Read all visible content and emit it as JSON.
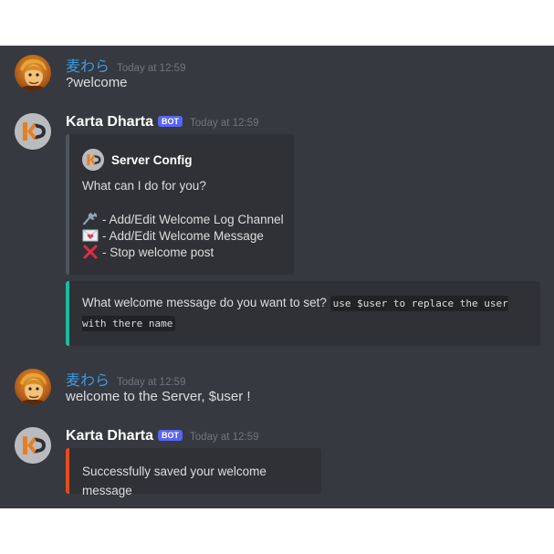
{
  "messages": [
    {
      "author": "麦わら",
      "timestamp": "Today at 12:59",
      "content": "?welcome"
    },
    {
      "author": "Karta Dharta",
      "bot_tag": "BOT",
      "timestamp": "Today at 12:59",
      "embed_config": {
        "author_name": "Server Config",
        "description": "What can I do for you?",
        "options": [
          {
            "icon": "wrench-icon",
            "label": "- Add/Edit Welcome Log Channel"
          },
          {
            "icon": "envelope-heart-icon",
            "label": "- Add/Edit Welcome Message"
          },
          {
            "icon": "cross-mark-icon",
            "label": "- Stop welcome post"
          }
        ],
        "color": "#4f545c"
      },
      "embed_prompt": {
        "text": "What welcome message do you want to set?",
        "code": "use $user to replace the user with there name",
        "color": "#1abc9c"
      }
    },
    {
      "author": "麦わら",
      "timestamp": "Today at 12:59",
      "content": "welcome to the Server, $user !"
    },
    {
      "author": "Karta Dharta",
      "bot_tag": "BOT",
      "timestamp": "Today at 12:59",
      "embed_result": {
        "text": "Successfully saved your welcome message",
        "color": "#e74c1c"
      }
    }
  ],
  "colors": {
    "background": "#36393f",
    "embed_bg": "#2f3136",
    "user_name": "#3c9be3",
    "bot_tag": "#5865f2"
  }
}
